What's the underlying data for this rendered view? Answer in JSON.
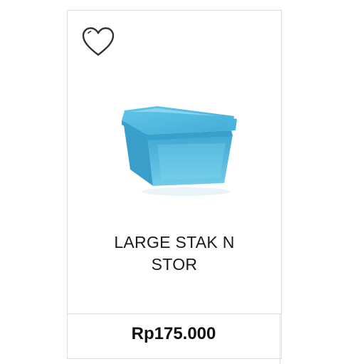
{
  "product": {
    "name_line1": "LARGE STAK N",
    "name_line2": "STOR",
    "price": "Rp175.000",
    "image_icon": "blue-storage-container",
    "wishlist_icon": "heart-icon"
  },
  "colors": {
    "border": "#dcdcdc",
    "text": "#1b1b1b",
    "container_blue": "#49b6dc",
    "container_lid": "#5cc3e6"
  }
}
